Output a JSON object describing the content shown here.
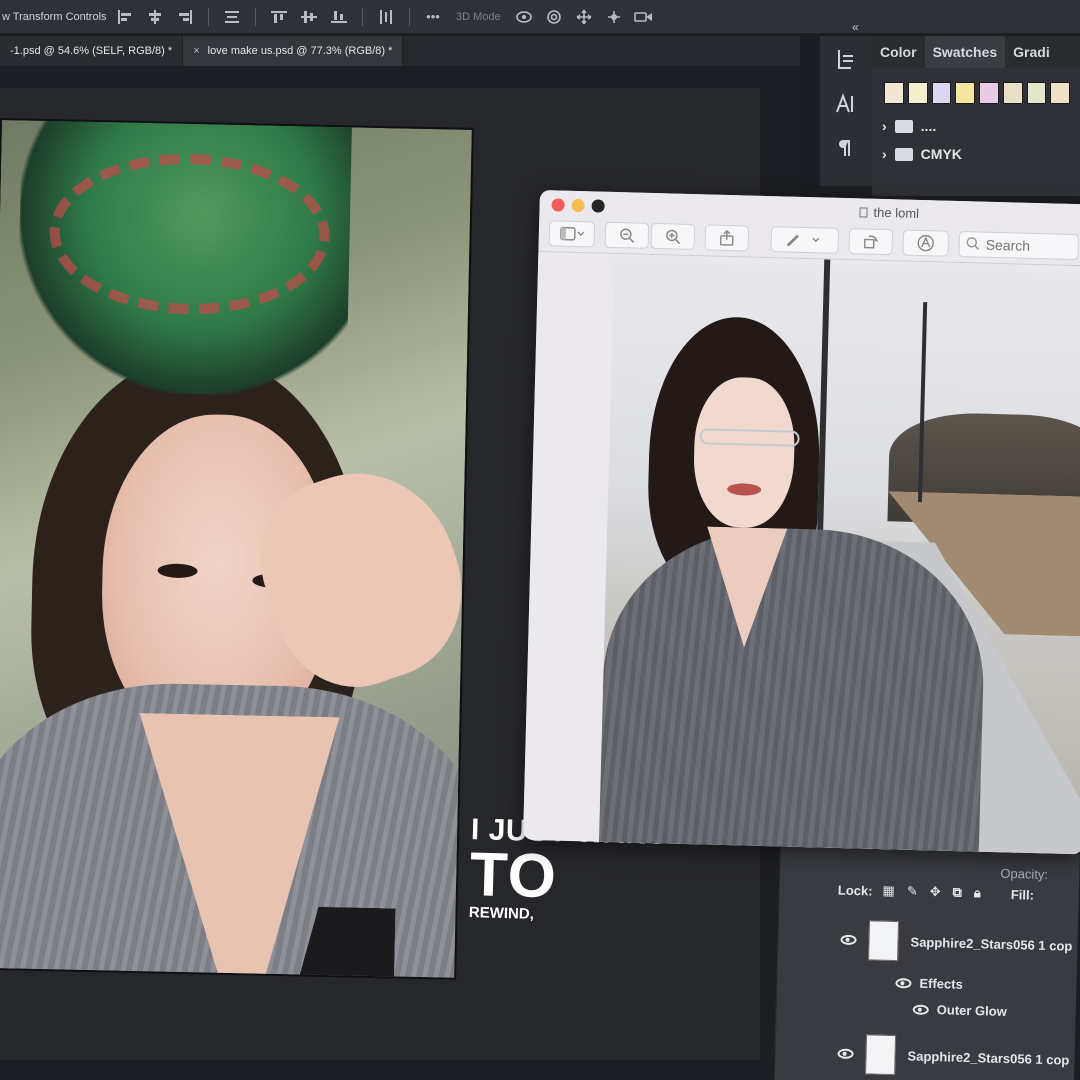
{
  "photoshop": {
    "options_bar": {
      "label": "w Transform Controls",
      "mode_3d": "3D Mode"
    },
    "tabs": [
      {
        "label": "-1.psd @ 54.6% (SELF, RGB/8) *"
      },
      {
        "label": "love make us.psd @ 77.3% (RGB/8) *"
      }
    ],
    "collapse_glyph": "«",
    "panel": {
      "tabs": [
        "Color",
        "Swatches",
        "Gradi"
      ],
      "swatch_colors": [
        "#f2e7d2",
        "#f4efcf",
        "#dcd8f2",
        "#f4e59f",
        "#e9cbe6",
        "#eadfc9",
        "#e3e7c9",
        "#f1e0c7"
      ],
      "folders": [
        {
          "label": "....",
          "icon": "folder-icon"
        },
        {
          "label": "CMYK",
          "icon": "folder-icon"
        }
      ]
    },
    "layers": {
      "header_fragment": "Opacity:",
      "lock_label": "Lock:",
      "fill_label": "Fill:",
      "items": [
        {
          "name": "Sapphire2_Stars056 1 cop",
          "effects_label": "Effects",
          "effect": "Outer Glow"
        },
        {
          "name": "Sapphire2_Stars056 1 cop"
        }
      ]
    }
  },
  "caption": {
    "line1": "I JUST WANT",
    "line2": "TO",
    "line3": "REWIND,"
  },
  "preview_window": {
    "title": "the loml",
    "search_placeholder": "Search",
    "traffic_colors": [
      "#ee5f58",
      "#f4bd4f",
      "#242424"
    ]
  }
}
